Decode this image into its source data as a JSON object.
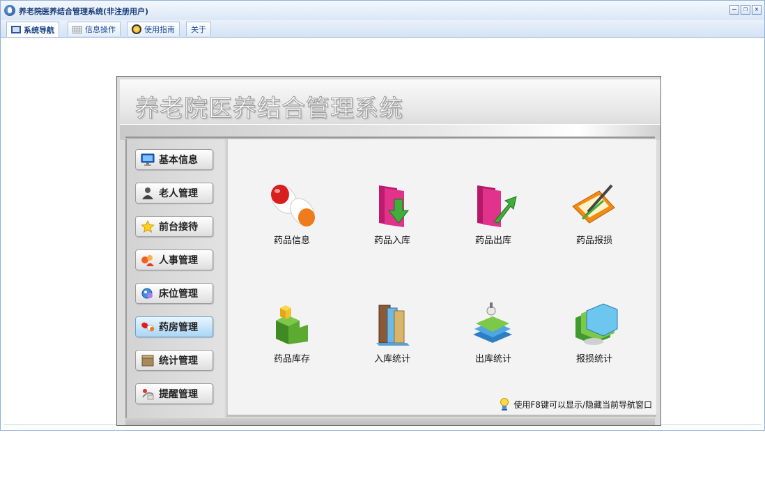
{
  "window": {
    "title": "养老院医养结合管理系统(非注册用户)",
    "minimize_glyph": "–",
    "restore_glyph": "❐",
    "close_glyph": "✕"
  },
  "tabs": [
    {
      "label": "系统导航",
      "icon": "monitor-icon",
      "active": true
    },
    {
      "label": "信息操作",
      "icon": "grid-icon",
      "active": false
    },
    {
      "label": "使用指南",
      "icon": "guide-icon",
      "active": false
    },
    {
      "label": "关于",
      "icon": "",
      "active": false
    }
  ],
  "banner": {
    "title": "养老院医养结合管理系统"
  },
  "sidebar": {
    "items": [
      {
        "label": "基本信息",
        "icon": "monitor-icon"
      },
      {
        "label": "老人管理",
        "icon": "person-icon"
      },
      {
        "label": "前台接待",
        "icon": "star-icon"
      },
      {
        "label": "人事管理",
        "icon": "staff-icon"
      },
      {
        "label": "床位管理",
        "icon": "bed-icon"
      },
      {
        "label": "药房管理",
        "icon": "pill-icon"
      },
      {
        "label": "统计管理",
        "icon": "box-icon"
      },
      {
        "label": "提醒管理",
        "icon": "pin-icon"
      }
    ],
    "active_index": 5
  },
  "modules": [
    {
      "label": "药品信息",
      "icon": "capsule-icon"
    },
    {
      "label": "药品入库",
      "icon": "folder-down-icon"
    },
    {
      "label": "药品出库",
      "icon": "folder-out-icon"
    },
    {
      "label": "药品报损",
      "icon": "pencil-edit-icon"
    },
    {
      "label": "药品库存",
      "icon": "green-cube-icon"
    },
    {
      "label": "入库统计",
      "icon": "books-icon"
    },
    {
      "label": "出库统计",
      "icon": "stack-icon"
    },
    {
      "label": "报损统计",
      "icon": "folders-icon"
    }
  ],
  "hint": {
    "text": "使用F8键可以显示/隐藏当前导航窗口",
    "icon": "lightbulb-icon"
  },
  "colors": {
    "title_text": "#153a76",
    "tab_text": "#1e4e9a",
    "active_nav": "#a9d6f5"
  }
}
